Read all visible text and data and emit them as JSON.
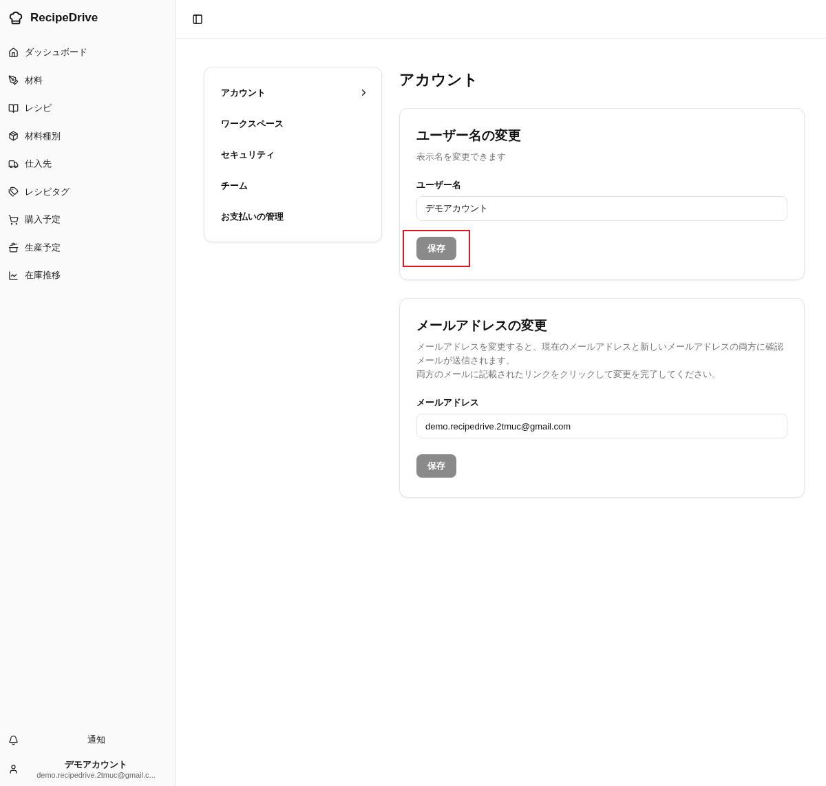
{
  "sidebar": {
    "brand": "RecipeDrive",
    "items": [
      {
        "label": "ダッシュボード"
      },
      {
        "label": "材料"
      },
      {
        "label": "レシピ"
      },
      {
        "label": "材料種別"
      },
      {
        "label": "仕入先"
      },
      {
        "label": "レシピタグ"
      },
      {
        "label": "購入予定"
      },
      {
        "label": "生産予定"
      },
      {
        "label": "在庫推移"
      }
    ],
    "notifications": "通知",
    "user": {
      "name": "デモアカウント",
      "email": "demo.recipedrive.2tmuc@gmail.c..."
    }
  },
  "settings_menu": [
    {
      "label": "アカウント",
      "selected": true
    },
    {
      "label": "ワークスペース",
      "selected": false
    },
    {
      "label": "セキュリティ",
      "selected": false
    },
    {
      "label": "チーム",
      "selected": false
    },
    {
      "label": "お支払いの管理",
      "selected": false
    }
  ],
  "page_title": "アカウント",
  "cards": [
    {
      "title": "ユーザー名の変更",
      "description": [
        "表示名を変更できます"
      ],
      "field_label": "ユーザー名",
      "value": "デモアカウント",
      "button": {
        "label": "保存",
        "disabled": true,
        "highlighted": true
      }
    },
    {
      "title": "メールアドレスの変更",
      "description": [
        "メールアドレスを変更すると、現在のメールアドレスと新しいメールアドレスの両方に確認メールが送信されます。",
        "両方のメールに記載されたリンクをクリックして変更を完了してください。"
      ],
      "field_label": "メールアドレス",
      "value": "demo.recipedrive.2tmuc@gmail.com",
      "button": {
        "label": "保存",
        "disabled": true,
        "highlighted": false
      }
    }
  ]
}
